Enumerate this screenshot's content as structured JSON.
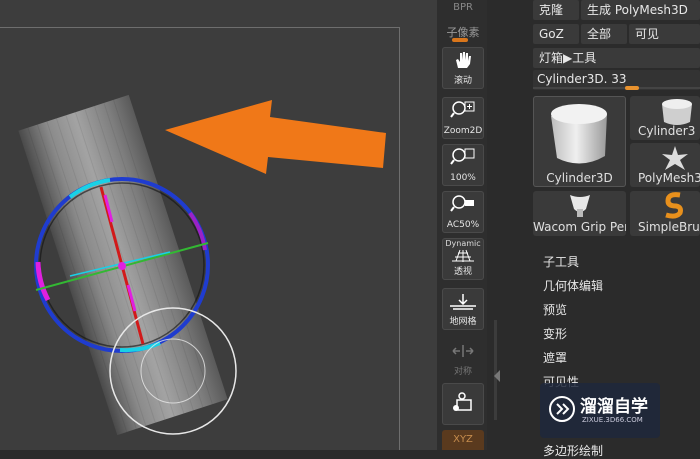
{
  "shelf": {
    "top_label": "BPR",
    "subpixel_label": "子像素",
    "buttons": [
      {
        "label": "滚动",
        "icon": "scroll-hand-icon"
      },
      {
        "label": "Zoom2D",
        "icon": "zoom-2d-icon"
      },
      {
        "label": "100%",
        "icon": "zoom-100-icon"
      },
      {
        "label": "AC50%",
        "icon": "zoom-ac50-icon"
      },
      {
        "label": "透视",
        "icon": "perspective-icon",
        "top_text": "Dynamic"
      },
      {
        "label": "地网格",
        "icon": "floor-grid-icon"
      },
      {
        "label": "对称",
        "icon": "symmetry-icon"
      },
      {
        "label": "",
        "icon": "local-transform-icon"
      },
      {
        "label": "XYZ",
        "icon": "xyz-icon"
      }
    ]
  },
  "panel": {
    "row1": {
      "clone": "克隆",
      "make_polymesh": "生成 PolyMesh3D"
    },
    "row2": {
      "goz": "GoZ",
      "all": "全部",
      "visible": "可见"
    },
    "lightbox": "灯箱▶工具",
    "slider": {
      "label": "Cylinder3D. 33",
      "value_fraction": 0.6
    },
    "tools": [
      {
        "name": "Cylinder3D",
        "icon": "cylinder-3d-icon"
      },
      {
        "name": "Cylinder3",
        "icon": "cylinder-small-icon"
      },
      {
        "name": "PolyMesh3",
        "icon": "polymesh-star-icon"
      },
      {
        "name": "Wacom Grip Pen",
        "icon": "grip-pen-icon"
      },
      {
        "name": "SimpleBru",
        "icon": "simple-brush-icon"
      }
    ],
    "menu": [
      "子工具",
      "几何体编辑",
      "预览",
      "变形",
      "遮罩",
      "可见性",
      "多边形绘制"
    ]
  },
  "watermark": {
    "title": "溜溜自学",
    "url": "ZIXUE.3D66.COM"
  },
  "colors": {
    "arrow": "#f07818",
    "ring_blue": "#1f3ccf",
    "axis_red": "#d11a1a",
    "axis_green": "#33b833",
    "magenta": "#e020e0",
    "cyan": "#19d1e6"
  }
}
